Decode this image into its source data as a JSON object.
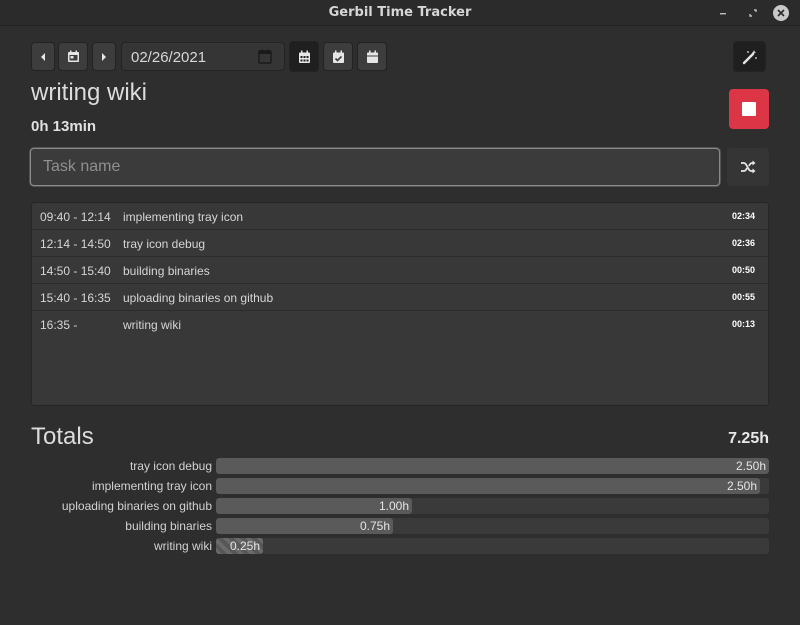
{
  "window": {
    "title": "Gerbil Time Tracker"
  },
  "toolbar": {
    "date_value": "02/26/2021"
  },
  "current_task": {
    "name": "writing wiki",
    "elapsed": "0h 13min"
  },
  "task_input": {
    "placeholder": "Task name",
    "value": ""
  },
  "entries": [
    {
      "time": "09:40 - 12:14",
      "name": "implementing tray icon",
      "duration": "02:34"
    },
    {
      "time": "12:14 - 14:50",
      "name": "tray icon debug",
      "duration": "02:36"
    },
    {
      "time": "14:50 - 15:40",
      "name": "building binaries",
      "duration": "00:50"
    },
    {
      "time": "15:40 - 16:35",
      "name": "uploading binaries on github",
      "duration": "00:55"
    },
    {
      "time": "16:35 -",
      "name": "writing wiki",
      "duration": "00:13"
    }
  ],
  "totals": {
    "title": "Totals",
    "sum": "7.25h",
    "max_hours": 2.6,
    "rows": [
      {
        "label": "tray icon debug",
        "value": "2.50h",
        "hours": 2.6,
        "active": false
      },
      {
        "label": "implementing tray icon",
        "value": "2.50h",
        "hours": 2.56,
        "active": false
      },
      {
        "label": "uploading binaries on github",
        "value": "1.00h",
        "hours": 0.92,
        "active": false
      },
      {
        "label": "building binaries",
        "value": "0.75h",
        "hours": 0.83,
        "active": false
      },
      {
        "label": "writing wiki",
        "value": "0.25h",
        "hours": 0.22,
        "active": true
      }
    ]
  },
  "colors": {
    "accent_stop": "#dc3545",
    "background": "#2e2e2e"
  },
  "icons": [
    "prev-icon",
    "calendar-icon",
    "next-icon",
    "calendar-week-icon",
    "calendar-check-icon",
    "calendar-icon",
    "magic-wand-icon",
    "stop-icon",
    "shuffle-icon"
  ]
}
